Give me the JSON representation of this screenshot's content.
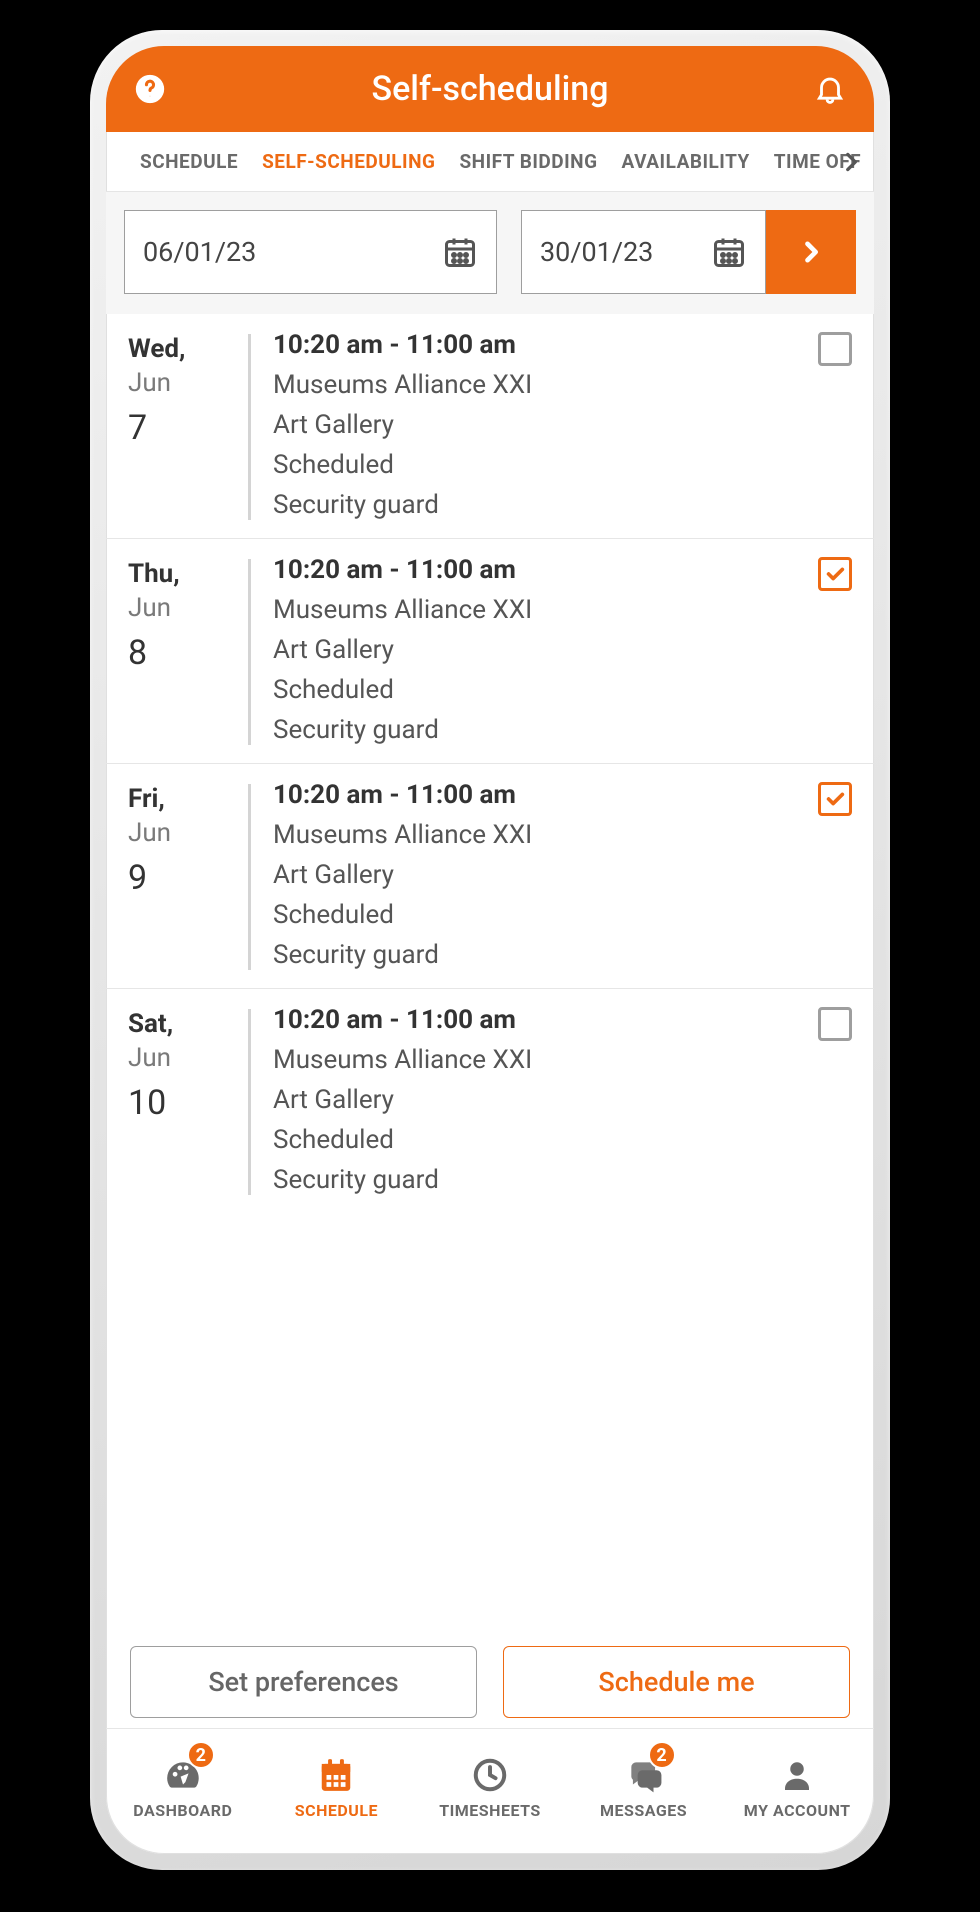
{
  "header": {
    "title": "Self-scheduling"
  },
  "tabs": [
    {
      "label": "SCHEDULE",
      "active": false
    },
    {
      "label": "SELF-SCHEDULING",
      "active": true
    },
    {
      "label": "SHIFT BIDDING",
      "active": false
    },
    {
      "label": "AVAILABILITY",
      "active": false
    },
    {
      "label": "TIME OFF",
      "active": false
    }
  ],
  "date_range": {
    "from": "06/01/23",
    "to": "30/01/23"
  },
  "shifts": [
    {
      "dow": "Wed,",
      "month": "Jun",
      "day": "7",
      "time": "10:20 am - 11:00 am",
      "org": "Museums Alliance XXI",
      "loc": "Art Gallery",
      "status": "Scheduled",
      "role": "Security guard",
      "checked": false
    },
    {
      "dow": "Thu,",
      "month": "Jun",
      "day": "8",
      "time": "10:20 am - 11:00 am",
      "org": "Museums Alliance XXI",
      "loc": "Art Gallery",
      "status": "Scheduled",
      "role": "Security guard",
      "checked": true
    },
    {
      "dow": "Fri,",
      "month": "Jun",
      "day": "9",
      "time": "10:20 am - 11:00 am",
      "org": "Museums Alliance XXI",
      "loc": "Art Gallery",
      "status": "Scheduled",
      "role": "Security guard",
      "checked": true
    },
    {
      "dow": "Sat,",
      "month": "Jun",
      "day": "10",
      "time": "10:20 am - 11:00 am",
      "org": "Museums Alliance XXI",
      "loc": "Art Gallery",
      "status": "Scheduled",
      "role": "Security guard",
      "checked": false
    }
  ],
  "actions": {
    "secondary": "Set preferences",
    "primary": "Schedule me"
  },
  "nav": [
    {
      "label": "DASHBOARD",
      "icon": "gauge",
      "active": false,
      "badge": "2"
    },
    {
      "label": "SCHEDULE",
      "icon": "calendar",
      "active": true,
      "badge": null
    },
    {
      "label": "TIMESHEETS",
      "icon": "clock",
      "active": false,
      "badge": null
    },
    {
      "label": "MESSAGES",
      "icon": "chat",
      "active": false,
      "badge": "2"
    },
    {
      "label": "MY ACCOUNT",
      "icon": "user",
      "active": false,
      "badge": null
    }
  ]
}
